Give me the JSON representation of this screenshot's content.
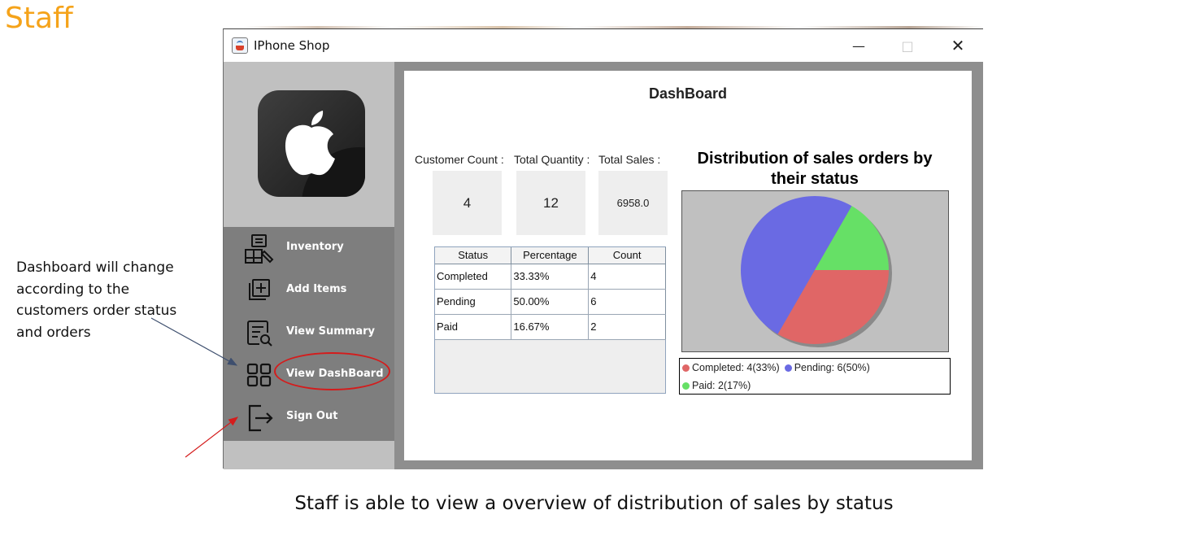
{
  "slide": {
    "title": "Staff",
    "annotation": "Dashboard will change according to the customers order status and orders",
    "caption": "Staff is able to view a overview of distribution of sales by status"
  },
  "window": {
    "title": "IPhone Shop",
    "controls": {
      "minimize": "—",
      "maximize": "□",
      "close": "✕"
    }
  },
  "sidebar": {
    "logo_icon": "apple-logo-icon",
    "items": [
      {
        "label": "Inventory",
        "icon": "inventory-icon"
      },
      {
        "label": "Add Items",
        "icon": "add-items-icon"
      },
      {
        "label": "View Summary",
        "icon": "summary-icon"
      },
      {
        "label": "View DashBoard",
        "icon": "dashboard-icon"
      },
      {
        "label": "Sign Out",
        "icon": "sign-out-icon"
      }
    ],
    "highlight_color": "#d41c1c"
  },
  "dashboard": {
    "title": "DashBoard",
    "stats": [
      {
        "label": "Customer Count :",
        "value": "4"
      },
      {
        "label": "Total Quantity :",
        "value": "12"
      },
      {
        "label": "Total Sales :",
        "value": "6958.0"
      }
    ],
    "table": {
      "headers": [
        "Status",
        "Percentage",
        "Count"
      ],
      "rows": [
        [
          "Completed",
          "33.33%",
          "4"
        ],
        [
          "Pending",
          "50.00%",
          "6"
        ],
        [
          "Paid",
          "16.67%",
          "2"
        ]
      ]
    }
  },
  "chart_data": {
    "type": "pie",
    "title": "Distribution of sales orders by their status",
    "title_line1": "Distribution of sales orders by",
    "title_line2": "their status",
    "categories": [
      "Completed",
      "Pending",
      "Paid"
    ],
    "values": [
      4,
      6,
      2
    ],
    "colors": [
      "#e06666",
      "#6a6ae3",
      "#66e066"
    ],
    "legend_labels": [
      "Completed: 4(33%)",
      "Pending: 6(50%)",
      "Paid: 2(17%)"
    ],
    "legend_placement": "bottom",
    "plot_background": "#c0c0c0"
  }
}
